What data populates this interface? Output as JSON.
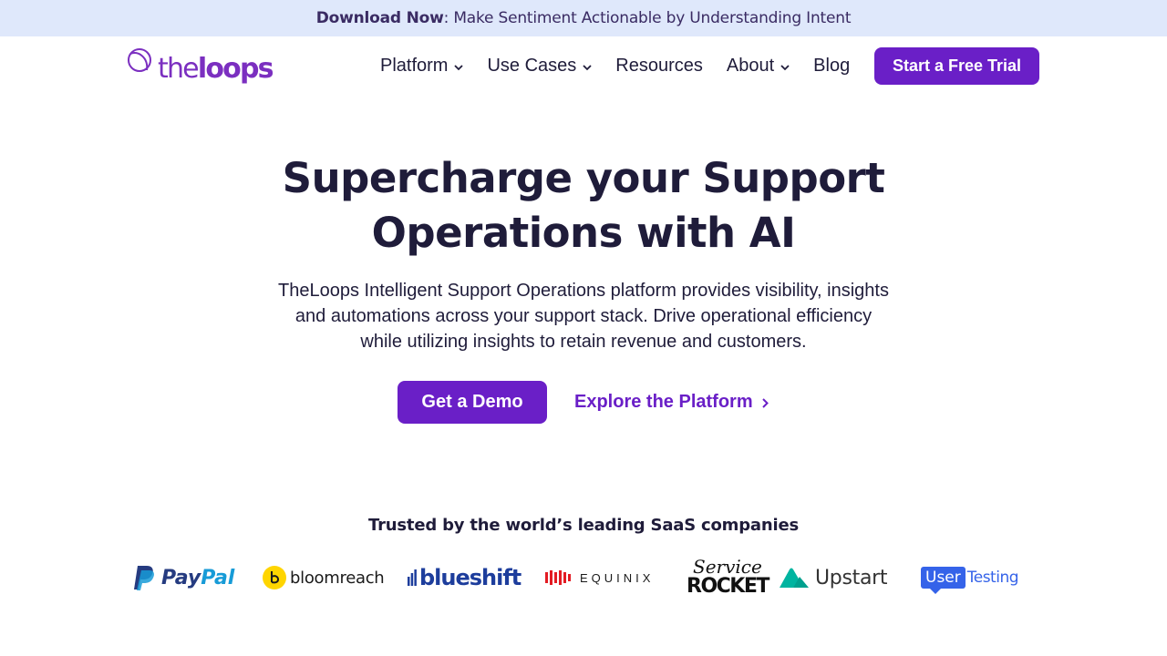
{
  "announcement": {
    "bold": "Download Now",
    "text": ": Make Sentiment Actionable by Understanding Intent"
  },
  "logo": {
    "part1": "the",
    "part2": "loops"
  },
  "nav": {
    "items": [
      {
        "label": "Platform",
        "dropdown": true
      },
      {
        "label": "Use Cases",
        "dropdown": true
      },
      {
        "label": "Resources",
        "dropdown": false
      },
      {
        "label": "About",
        "dropdown": true
      },
      {
        "label": "Blog",
        "dropdown": false
      }
    ],
    "cta": "Start a Free Trial"
  },
  "hero": {
    "title_line1": "Supercharge your Support",
    "title_line2": "Operations with AI",
    "subtitle_line1": "TheLoops Intelligent Support Operations platform provides visibility, insights",
    "subtitle_line2": "and automations across your support stack. Drive operational efficiency",
    "subtitle_line3": "while utilizing insights to retain revenue and customers.",
    "primary_cta": "Get a Demo",
    "secondary_cta": "Explore the Platform"
  },
  "trusted": {
    "heading": "Trusted by the world’s leading SaaS companies",
    "logos": {
      "paypal_1": "Pay",
      "paypal_2": "Pal",
      "bloomreach": "bloomreach",
      "blueshift": "blueshift",
      "equinix": "EQUINIX",
      "servicerocket_1": "Service",
      "servicerocket_2": "ROCKET",
      "upstart": "Upstart",
      "usertesting_1": "User",
      "usertesting_2": "Testing"
    }
  },
  "colors": {
    "brand_purple": "#6a1fc7",
    "announce_bg": "#dfe8fb",
    "text_dark": "#1f1c3a"
  }
}
